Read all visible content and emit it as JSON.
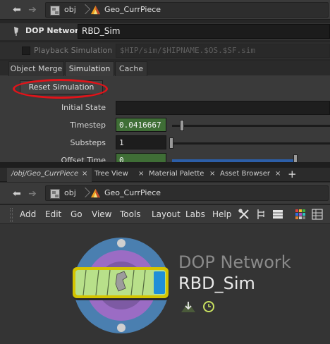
{
  "top_path": {
    "crumbs": [
      "obj",
      "Geo_CurrPiece"
    ]
  },
  "param_pane": {
    "node_type": "DOP Network",
    "node_name": "RBD_Sim",
    "playback_label": "Playback Simulation",
    "playback_path": "$HIP/sim/$HIPNAME.$OS.$SF.sim",
    "tabs": [
      "Object Merge",
      "Simulation",
      "Cache"
    ],
    "active_tab": "Simulation",
    "reset_button": "Reset Simulation",
    "params": {
      "initial_state_label": "Initial State",
      "initial_state_value": "",
      "timestep_label": "Timestep",
      "timestep_value": "0.0416667",
      "substeps_label": "Substeps",
      "substeps_value": "1",
      "offset_time_label": "Offset Time",
      "offset_time_value": "0"
    }
  },
  "pane_tabs": [
    {
      "label": "/obj/Geo_CurrPiece",
      "active": true
    },
    {
      "label": "Tree View",
      "active": false
    },
    {
      "label": "Material Palette",
      "active": false
    },
    {
      "label": "Asset Browser",
      "active": false
    }
  ],
  "add_tab_symbol": "+",
  "close_symbol": "×",
  "network_path": {
    "crumbs": [
      "obj",
      "Geo_CurrPiece"
    ]
  },
  "menu": [
    "Add",
    "Edit",
    "Go",
    "View",
    "Tools",
    "Layout",
    "Labs",
    "Help"
  ],
  "toolbar_icons": [
    "wrench-scissors-icon",
    "tree-layout-icon",
    "list-icon",
    "color-palette-icon",
    "grid-icon"
  ],
  "node": {
    "type_label": "DOP Network",
    "name": "RBD_Sim",
    "colors": {
      "node_body": "#b8e08a",
      "node_border": "#d4c400",
      "selection_ring": "#4a7fb0",
      "inner_ring": "#9b6cc4",
      "flag_blue": "#1f8fd8"
    }
  }
}
